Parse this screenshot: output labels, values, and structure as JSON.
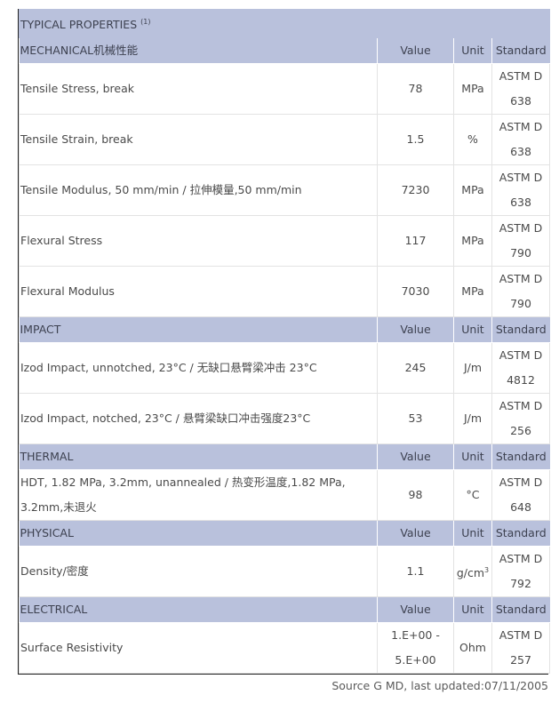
{
  "title": "TYPICAL PROPERTIES",
  "title_note": "(1)",
  "columns": {
    "value": "Value",
    "unit": "Unit",
    "standard": "Standard"
  },
  "sections": [
    {
      "name": "MECHANICAL机械性能",
      "rows": [
        {
          "property": "Tensile Stress, break",
          "value": "78",
          "unit": "MPa",
          "standard_1": "ASTM D",
          "standard_2": "638"
        },
        {
          "property": "Tensile Strain, break",
          "value": "1.5",
          "unit": "%",
          "standard_1": "ASTM D",
          "standard_2": "638"
        },
        {
          "property": "Tensile Modulus, 50 mm/min / 拉伸模量,50 mm/min",
          "value": "7230",
          "unit": "MPa",
          "standard_1": "ASTM D",
          "standard_2": "638"
        },
        {
          "property": "Flexural Stress",
          "value": "117",
          "unit": "MPa",
          "standard_1": "ASTM D",
          "standard_2": "790"
        },
        {
          "property": "Flexural Modulus",
          "value": "7030",
          "unit": "MPa",
          "standard_1": "ASTM D",
          "standard_2": "790"
        }
      ]
    },
    {
      "name": "IMPACT",
      "rows": [
        {
          "property": "Izod Impact, unnotched, 23°C / 无缺口悬臂梁冲击 23°C",
          "value": "245",
          "unit": "J/m",
          "standard_1": "ASTM D",
          "standard_2": "4812"
        },
        {
          "property": "Izod Impact, notched, 23°C / 悬臂梁缺口冲击强度23°C",
          "value": "53",
          "unit": "J/m",
          "standard_1": "ASTM D",
          "standard_2": "256"
        }
      ]
    },
    {
      "name": "THERMAL",
      "rows": [
        {
          "property_1": "HDT, 1.82 MPa, 3.2mm, unannealed / 热变形温度,1.82 MPa,",
          "property_2": "3.2mm,未退火",
          "value": "98",
          "unit": "°C",
          "standard_1": "ASTM D",
          "standard_2": "648"
        }
      ]
    },
    {
      "name": "PHYSICAL",
      "rows": [
        {
          "property": "Density/密度",
          "value": "1.1",
          "unit": "g/cm",
          "unit_sup": "3",
          "standard_1": "ASTM D",
          "standard_2": "792"
        }
      ]
    },
    {
      "name": "ELECTRICAL",
      "rows": [
        {
          "property": "Surface Resistivity",
          "value_1": "1.E+00 -",
          "value_2": "5.E+00",
          "unit": "Ohm",
          "standard_1": "ASTM D",
          "standard_2": "257"
        }
      ]
    }
  ],
  "footer": "Source G MD, last updated:07/11/2005"
}
